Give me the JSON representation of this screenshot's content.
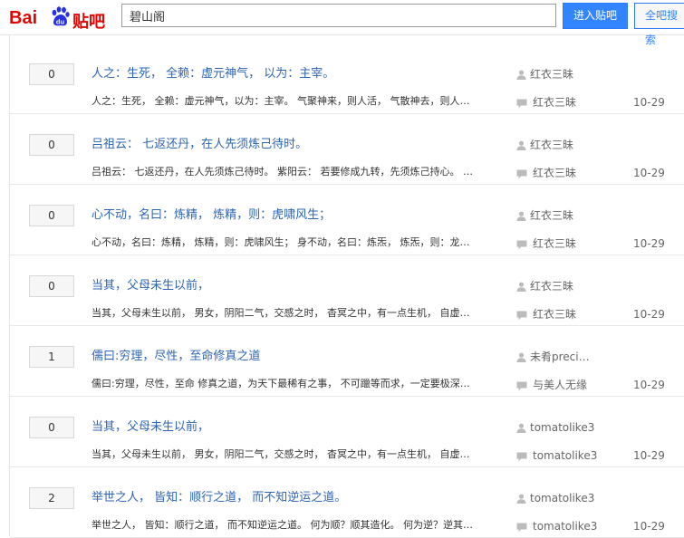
{
  "header": {
    "logo_bai": "Bai",
    "logo_du": "du",
    "logo_tieba": "贴吧",
    "search_value": "碧山阁",
    "enter_button": "进入贴吧",
    "search_button": "全吧搜索"
  },
  "colors": {
    "accent": "#3385ff",
    "link": "#2d64b3",
    "brand_red": "#e10601"
  },
  "icons": {
    "author": "user-icon",
    "last_reply": "reply-bubble-icon"
  },
  "threads": [
    {
      "replies": "0",
      "title": "人之：生死， 全赖：虚元神气， 以为：主宰。",
      "abstract": "人之：生死， 全赖：虚元神气，以为：主宰。 气聚神来，则人活， 气散神去，则人…",
      "author": "红衣三昧",
      "last_reply_user": "红衣三昧",
      "last_reply_time": "10-29"
    },
    {
      "replies": "0",
      "title": "吕祖云： 七返还丹，在人先须炼己待时。",
      "abstract": "吕祖云： 七返还丹，在人先须炼己待时。 紫阳云： 若要修成九转，先须炼己持心。 …",
      "author": "红衣三昧",
      "last_reply_user": "红衣三昧",
      "last_reply_time": "10-29"
    },
    {
      "replies": "0",
      "title": "心不动，名曰：炼精， 炼精，则：虎啸风生；",
      "abstract": "心不动，名曰：炼精， 炼精，则：虎啸风生； 身不动，名曰：炼炁， 炼炁，则：龙…",
      "author": "红衣三昧",
      "last_reply_user": "红衣三昧",
      "last_reply_time": "10-29"
    },
    {
      "replies": "0",
      "title": "当其，父母未生以前，",
      "abstract": "当其，父母未生以前， 男女，阴阳二气，交感之时， 杳冥之中，有一点生机， 自虚…",
      "author": "红衣三昧",
      "last_reply_user": "红衣三昧",
      "last_reply_time": "10-29"
    },
    {
      "replies": "1",
      "title": "儒曰:穷理，尽性，至命修真之道",
      "abstract": "儒曰:穷理，尽性，至命 修真之道，为天下最稀有之事， 不可躐等而求，一定要极深…",
      "author": "未肴preci…",
      "last_reply_user": "与美人无缘",
      "last_reply_time": "10-29"
    },
    {
      "replies": "0",
      "title": "当其，父母未生以前，",
      "abstract": "当其，父母未生以前， 男女，阴阳二气，交感之时， 杳冥之中，有一点生机， 自虚…",
      "author": "tomatolike3",
      "last_reply_user": "tomatolike3",
      "last_reply_time": "10-29"
    },
    {
      "replies": "2",
      "title": "举世之人， 皆知：顺行之道， 而不知逆运之道。",
      "abstract": "举世之人， 皆知：顺行之道， 而不知逆运之道。 何为顺？顺其造化。 何为逆？逆其…",
      "author": "tomatolike3",
      "last_reply_user": "tomatolike3",
      "last_reply_time": "10-29"
    }
  ]
}
